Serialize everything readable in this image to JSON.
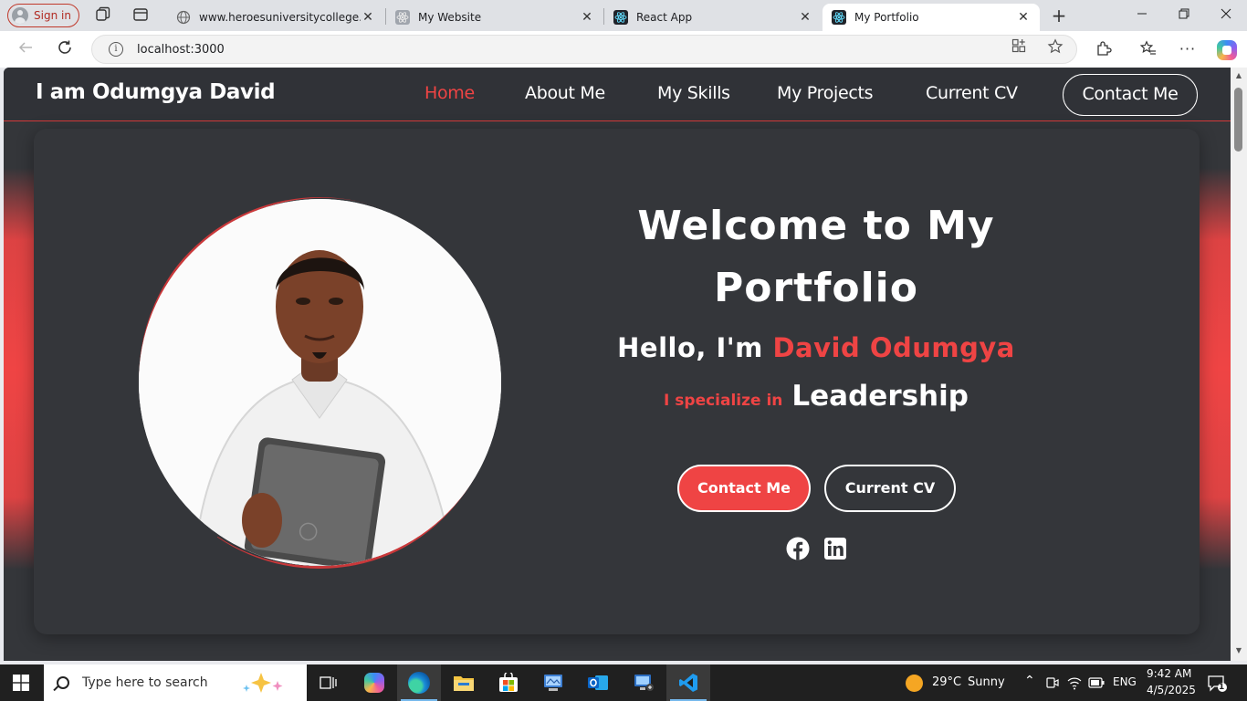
{
  "browser": {
    "signin_label": "Sign in",
    "tabs": [
      {
        "title": "www.heroesuniversitycollege.com",
        "favicon": "globe-icon",
        "active": false
      },
      {
        "title": "My Website",
        "favicon": "react-icon",
        "active": false
      },
      {
        "title": "React App",
        "favicon": "react-icon",
        "active": false
      },
      {
        "title": "My Portfolio",
        "favicon": "react-icon",
        "active": true
      }
    ],
    "new_tab_glyph": "+",
    "address": "localhost:3000"
  },
  "site": {
    "brand": "I am Odumgya David",
    "nav": [
      "Home",
      "About Me",
      "My Skills",
      "My Projects",
      "Current CV"
    ],
    "nav_active": "Home",
    "nav_cta": "Contact Me",
    "hero": {
      "title": "Welcome to My Portfolio",
      "hello_prefix": "Hello, I'm ",
      "name": "David Odumgya",
      "specialize_label": "I specialize in",
      "specialty": "Leadership",
      "primary_button": "Contact Me",
      "secondary_button": "Current CV",
      "socials": [
        "facebook-icon",
        "linkedin-icon"
      ]
    },
    "colors": {
      "accent": "#ef4444",
      "background": "#34363a",
      "nav_bg": "#303237"
    }
  },
  "taskbar": {
    "search_placeholder": "Type here to search",
    "weather_temp": "29°C",
    "weather_desc": "Sunny",
    "language": "ENG",
    "time": "9:42 AM",
    "date": "4/5/2025",
    "notification_count": "1"
  }
}
